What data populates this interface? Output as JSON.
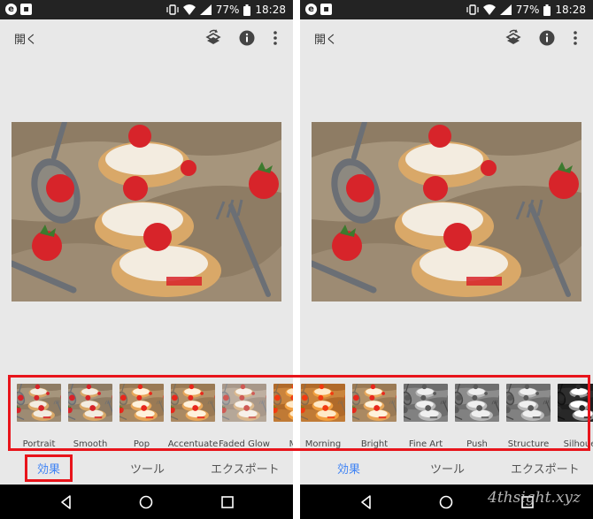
{
  "left_screen": {
    "status": {
      "battery": "77%",
      "time": "18:28"
    },
    "toolbar": {
      "open_label": "開く"
    },
    "filters": [
      {
        "label": "Portrait",
        "style": "normal"
      },
      {
        "label": "Smooth",
        "style": "normal"
      },
      {
        "label": "Pop",
        "style": "warm"
      },
      {
        "label": "Accentuate",
        "style": "warm"
      },
      {
        "label": "Faded Glow",
        "style": "faded"
      },
      {
        "label": "Mo",
        "style": "orange"
      }
    ],
    "tabs": {
      "effects": "効果",
      "tools": "ツール",
      "export": "エクスポート",
      "active": "effects"
    }
  },
  "right_screen": {
    "status": {
      "battery": "77%",
      "time": "18:28"
    },
    "toolbar": {
      "open_label": "開く"
    },
    "filters": [
      {
        "label": "Morning",
        "style": "orange"
      },
      {
        "label": "Bright",
        "style": "warm"
      },
      {
        "label": "Fine Art",
        "style": "bw"
      },
      {
        "label": "Push",
        "style": "bw"
      },
      {
        "label": "Structure",
        "style": "bw"
      },
      {
        "label": "Silhoue",
        "style": "bwdark"
      }
    ],
    "tabs": {
      "effects": "効果",
      "tools": "ツール",
      "export": "エクスポート",
      "active": "effects"
    }
  },
  "watermark": "4thsight.xyz",
  "colors": {
    "accent": "#4285f4",
    "highlight": "#e8141b",
    "statusbar": "#232323",
    "navbar": "#000000",
    "background": "#e8e8e8"
  }
}
